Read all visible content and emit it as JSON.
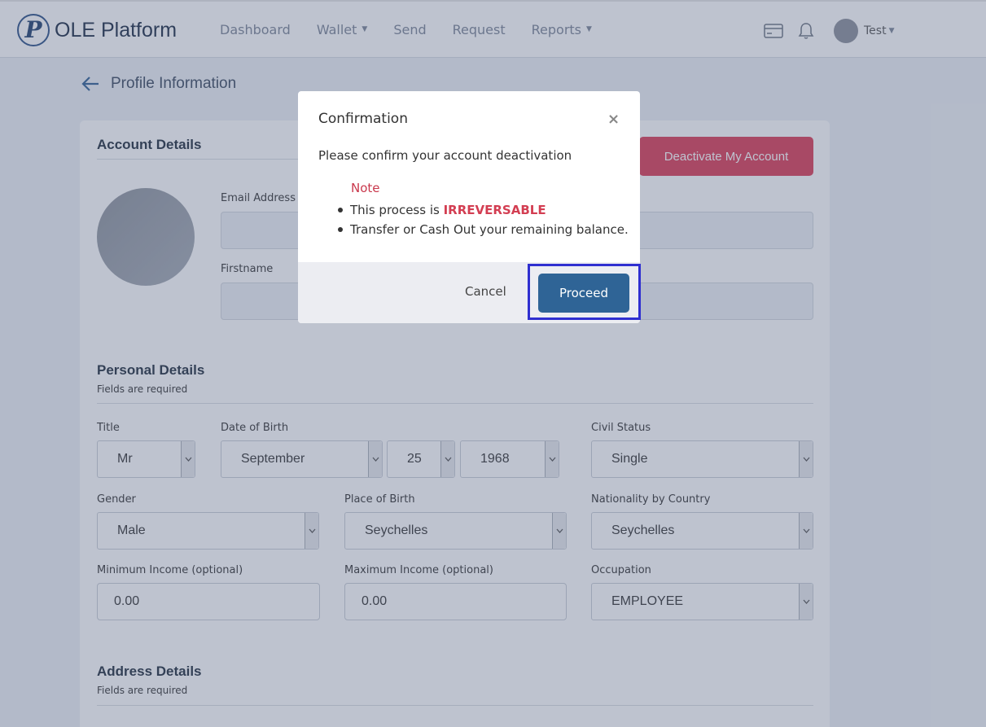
{
  "navbar": {
    "brand_letter": "P",
    "brand_name": "OLE Platform",
    "links": [
      "Dashboard",
      "Wallet",
      "Send",
      "Request",
      "Reports"
    ],
    "user_name": "Test"
  },
  "page": {
    "title": "Profile Information"
  },
  "account_details": {
    "title": "Account Details",
    "deactivate_label": "Deactivate My Account",
    "email_label": "Email Address",
    "firstname_label": "Firstname"
  },
  "personal_details": {
    "title": "Personal Details",
    "subtitle": "Fields are required",
    "title_label": "Title",
    "title_value": "Mr",
    "dob_label": "Date of Birth",
    "dob_month": "September",
    "dob_day": "25",
    "dob_year": "1968",
    "civil_label": "Civil Status",
    "civil_value": "Single",
    "gender_label": "Gender",
    "gender_value": "Male",
    "pob_label": "Place of Birth",
    "pob_value": "Seychelles",
    "nationality_label": "Nationality by Country",
    "nationality_value": "Seychelles",
    "min_income_label": "Minimum Income (optional)",
    "min_income_value": "0.00",
    "max_income_label": "Maximum Income (optional)",
    "max_income_value": "0.00",
    "occupation_label": "Occupation",
    "occupation_value": "EMPLOYEE"
  },
  "address_details": {
    "title": "Address Details",
    "subtitle": "Fields are required"
  },
  "modal": {
    "title": "Confirmation",
    "close": "×",
    "message": "Please confirm your account deactivation",
    "note_label": "Note",
    "note1_prefix": "This process is ",
    "note1_strong": "IRREVERSABLE",
    "note2": "Transfer or Cash Out your remaining balance.",
    "cancel_label": "Cancel",
    "proceed_label": "Proceed"
  },
  "colors": {
    "danger": "#dc3b55",
    "primary": "#2f6496",
    "highlight": "#2f2fd0"
  }
}
